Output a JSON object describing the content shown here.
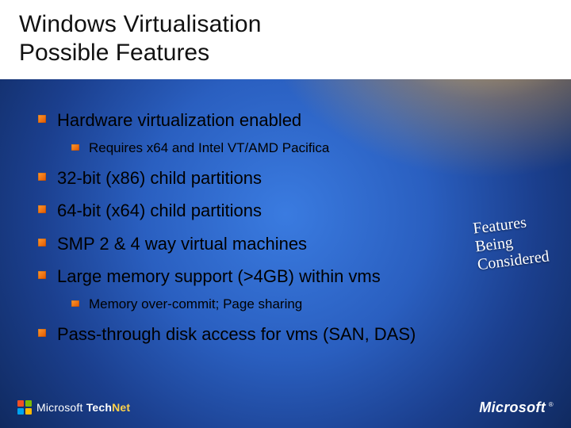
{
  "title": {
    "line1": "Windows Virtualisation",
    "line2": "Possible Features"
  },
  "bullets": [
    {
      "text": "Hardware virtualization enabled",
      "children": [
        {
          "text": "Requires x64 and Intel VT/AMD Pacifica"
        }
      ]
    },
    {
      "text": "32-bit (x86) child partitions"
    },
    {
      "text": "64-bit (x64) child partitions"
    },
    {
      "text": "SMP 2 & 4 way virtual machines"
    },
    {
      "text": "Large memory support (>4GB) within vms",
      "children": [
        {
          "text": "Memory over-commit; Page sharing"
        }
      ]
    },
    {
      "text": "Pass-through disk access for vms (SAN, DAS)"
    }
  ],
  "callout": "Features\nBeing\nConsidered",
  "footer": {
    "left_brand_prefix": "Microsoft",
    "left_brand_tech": "Tech",
    "left_brand_net": "Net",
    "right_brand": "Microsoft"
  }
}
